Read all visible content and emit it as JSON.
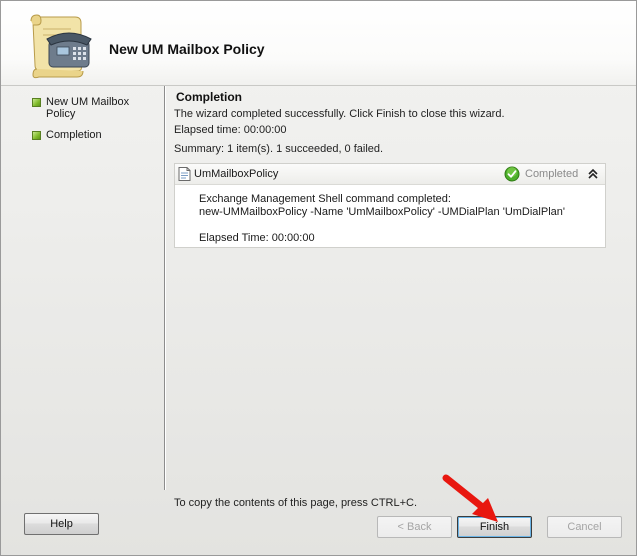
{
  "header": {
    "title": "New UM Mailbox Policy",
    "icon": "phone-scroll-icon"
  },
  "sidebar": {
    "steps": [
      {
        "label": "New UM Mailbox Policy",
        "icon": "step-complete-icon"
      },
      {
        "label": "Completion",
        "icon": "step-complete-icon"
      }
    ]
  },
  "main": {
    "title": "Completion",
    "message": "The wizard completed successfully. Click Finish to close this wizard.",
    "elapsed": "Elapsed time: 00:00:00",
    "summary": "Summary: 1 item(s). 1 succeeded, 0 failed.",
    "result": {
      "name": "UmMailboxPolicy",
      "status": "Completed",
      "lines": [
        "Exchange Management Shell command completed:",
        "new-UMMailboxPolicy -Name 'UmMailboxPolicy' -UMDialPlan 'UmDialPlan'",
        "",
        "Elapsed Time: 00:00:00"
      ]
    },
    "copy_hint": "To copy the contents of this page, press CTRL+C."
  },
  "buttons": {
    "help": "Help",
    "back": "< Back",
    "finish": "Finish",
    "cancel": "Cancel"
  },
  "colors": {
    "step_bullet": "#7fba2a",
    "status_ok": "#4caf2a",
    "arrow": "#e8170f"
  }
}
